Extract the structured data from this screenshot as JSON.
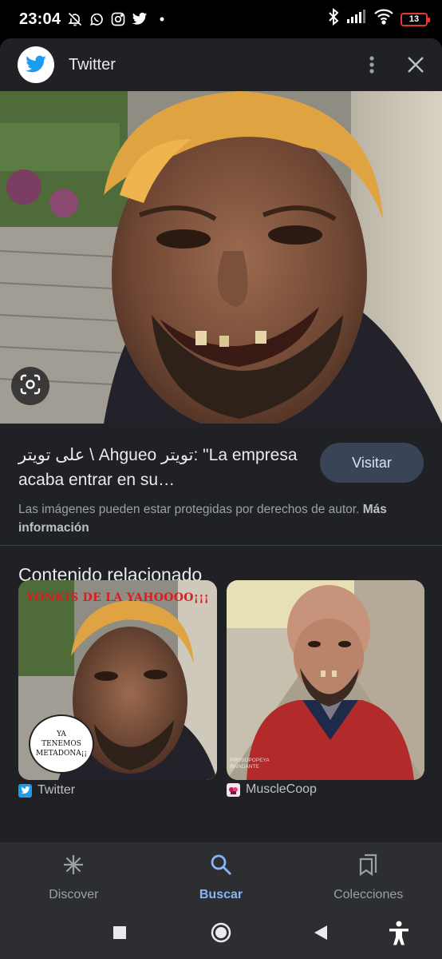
{
  "status_bar": {
    "time": "23:04",
    "battery": "13",
    "icons": [
      "bell-off-icon",
      "whatsapp-icon",
      "instagram-icon",
      "twitter-icon",
      "dot-icon",
      "bluetooth-icon",
      "signal-icon",
      "wifi-icon",
      "battery-icon"
    ]
  },
  "sheet": {
    "title": "Twitter",
    "logo": "twitter-bird-icon",
    "actions": [
      "more-vert-icon",
      "close-icon"
    ]
  },
  "result": {
    "title": "على تويتر \\ Ahgueo تويتر: \"La empresa acaba entrar en su…",
    "visit_label": "Visitar",
    "copyright_text": "Las imágenes pueden estar protegidas por derechos de autor.",
    "more_info": "Más información"
  },
  "related": {
    "heading": "Contenido relacionado",
    "items": [
      {
        "source": "Twitter",
        "banner": "YONKIS DE LA YAHOOOO¡¡¡",
        "bubble": "YA TENEMOS METADONA¡¡"
      },
      {
        "source": "MuscleCoop",
        "watermark": "PROSOPOPEYA INVADANTE"
      }
    ]
  },
  "bottom_nav": {
    "items": [
      {
        "label": "Discover",
        "icon": "asterisk-icon"
      },
      {
        "label": "Buscar",
        "icon": "search-icon"
      },
      {
        "label": "Colecciones",
        "icon": "collections-icon"
      }
    ],
    "active": "Buscar"
  },
  "colors": {
    "accent": "#8ab4f8",
    "sheet_bg": "#202124",
    "nav_bg": "#2d2e31",
    "visit_button_bg": "#394457",
    "twitter_blue": "#1d9bf0"
  }
}
